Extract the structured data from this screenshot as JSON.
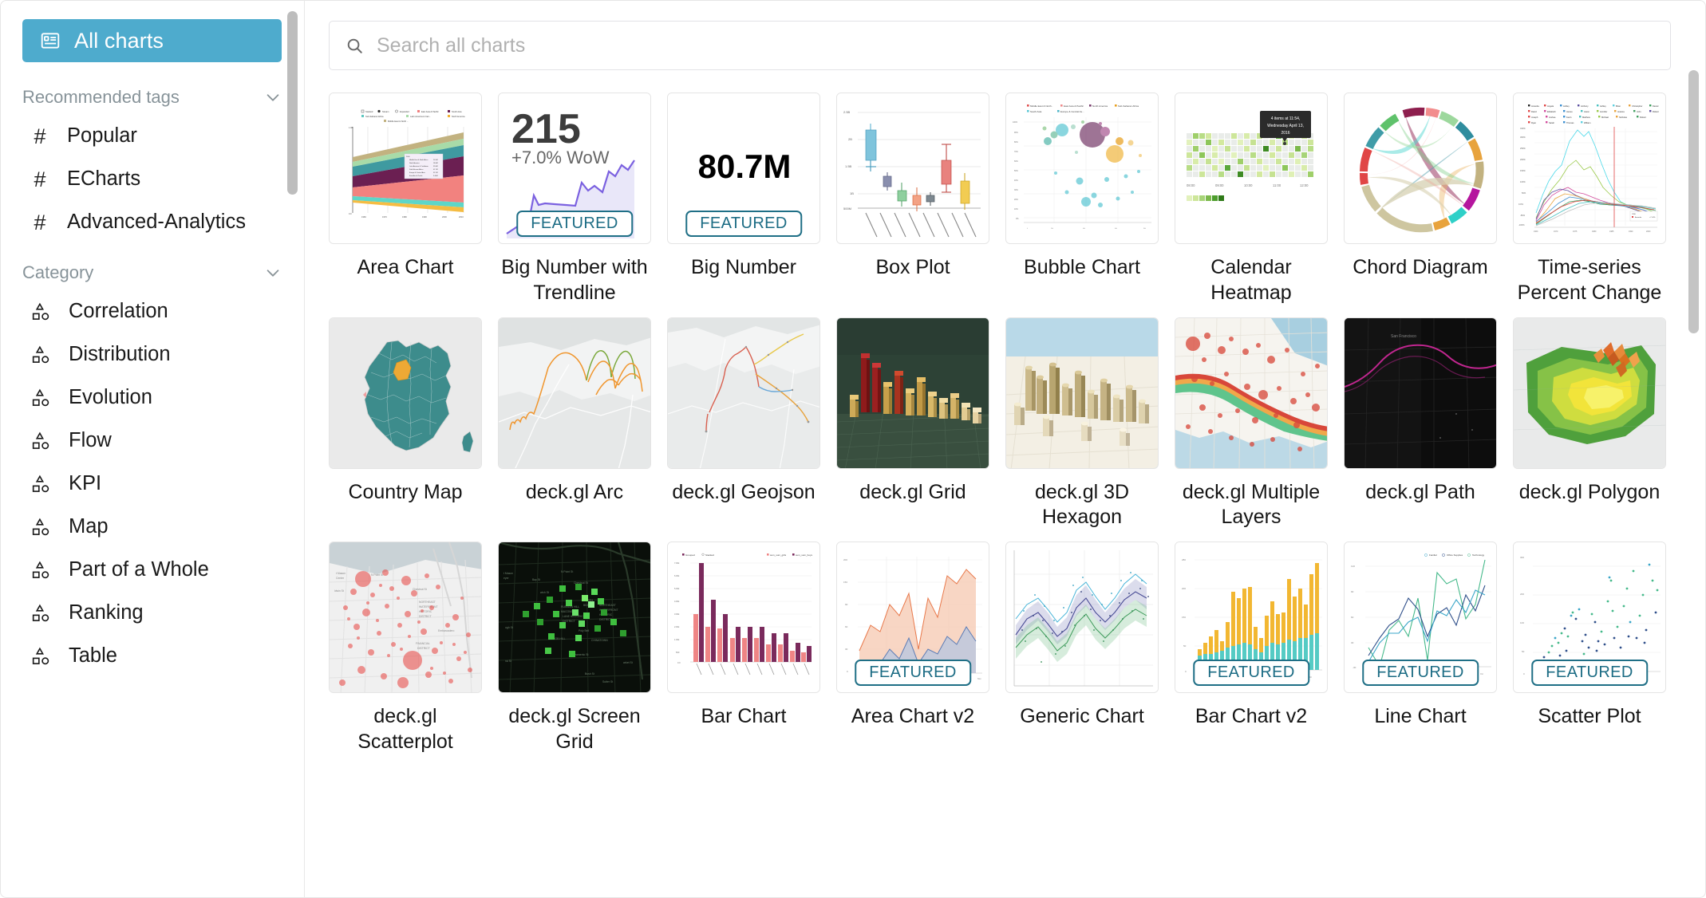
{
  "sidebar": {
    "all_charts": {
      "label": "All charts",
      "icon": "all-charts-icon"
    },
    "tags_header": {
      "label": "Recommended tags",
      "icon": "chevron-down-icon"
    },
    "tags": [
      {
        "label": "Popular",
        "icon": "hash-icon"
      },
      {
        "label": "ECharts",
        "icon": "hash-icon"
      },
      {
        "label": "Advanced-Analytics",
        "icon": "hash-icon"
      }
    ],
    "category_header": {
      "label": "Category",
      "icon": "chevron-down-icon"
    },
    "categories": [
      {
        "label": "Correlation",
        "icon": "shapes-icon"
      },
      {
        "label": "Distribution",
        "icon": "shapes-icon"
      },
      {
        "label": "Evolution",
        "icon": "shapes-icon"
      },
      {
        "label": "Flow",
        "icon": "shapes-icon"
      },
      {
        "label": "KPI",
        "icon": "shapes-icon"
      },
      {
        "label": "Map",
        "icon": "shapes-icon"
      },
      {
        "label": "Part of a Whole",
        "icon": "shapes-icon"
      },
      {
        "label": "Ranking",
        "icon": "shapes-icon"
      },
      {
        "label": "Table",
        "icon": "shapes-icon"
      }
    ]
  },
  "search": {
    "placeholder": "Search all charts",
    "value": "",
    "icon": "search-icon"
  },
  "badges": {
    "featured": "FEATURED"
  },
  "thumbnail_text": {
    "big_number_trendline_value": "215",
    "big_number_trendline_subheader": "+7.0% WoW",
    "big_number_value": "80.7M",
    "calendar_tooltip_line1": "4 items at 11:54,",
    "calendar_tooltip_line2": "Wednesday April 13,",
    "calendar_tooltip_line3": "2016",
    "calendar_axis": [
      "08:00",
      "09:00",
      "10:00",
      "11:00",
      "12:00"
    ]
  },
  "colors": {
    "accent": "#4eabcd",
    "featured_border": "#1f6f86",
    "featured_text": "#1c6c84",
    "sidebar_muted": "#879399",
    "text": "#151515"
  },
  "gallery": [
    {
      "name": "Area Chart",
      "thumb": "area-chart",
      "featured": false
    },
    {
      "name": "Big Number with Trendline",
      "thumb": "big-number-trendline",
      "featured": true
    },
    {
      "name": "Big Number",
      "thumb": "big-number",
      "featured": true
    },
    {
      "name": "Box Plot",
      "thumb": "box-plot",
      "featured": false
    },
    {
      "name": "Bubble Chart",
      "thumb": "bubble-chart",
      "featured": false
    },
    {
      "name": "Calendar Heatmap",
      "thumb": "calendar-heatmap",
      "featured": false
    },
    {
      "name": "Chord Diagram",
      "thumb": "chord-diagram",
      "featured": false
    },
    {
      "name": "Time-series Percent Change",
      "thumb": "time-series-percent-change",
      "featured": false
    },
    {
      "name": "Country Map",
      "thumb": "country-map",
      "featured": false
    },
    {
      "name": "deck.gl Arc",
      "thumb": "deckgl-arc",
      "featured": false
    },
    {
      "name": "deck.gl Geojson",
      "thumb": "deckgl-geojson",
      "featured": false
    },
    {
      "name": "deck.gl Grid",
      "thumb": "deckgl-grid",
      "featured": false
    },
    {
      "name": "deck.gl 3D Hexagon",
      "thumb": "deckgl-hexagon",
      "featured": false
    },
    {
      "name": "deck.gl Multiple Layers",
      "thumb": "deckgl-multi",
      "featured": false
    },
    {
      "name": "deck.gl Path",
      "thumb": "deckgl-path",
      "featured": false
    },
    {
      "name": "deck.gl Polygon",
      "thumb": "deckgl-polygon",
      "featured": false
    },
    {
      "name": "deck.gl Scatterplot",
      "thumb": "deckgl-scatterplot",
      "featured": false
    },
    {
      "name": "deck.gl Screen Grid",
      "thumb": "deckgl-screengrid",
      "featured": false
    },
    {
      "name": "Bar Chart",
      "thumb": "bar-chart",
      "featured": false
    },
    {
      "name": "Area Chart v2",
      "thumb": "area-chart-v2",
      "featured": true
    },
    {
      "name": "Generic Chart",
      "thumb": "generic-chart",
      "featured": false
    },
    {
      "name": "Bar Chart v2",
      "thumb": "bar-chart-v2",
      "featured": true
    },
    {
      "name": "Line Chart",
      "thumb": "line-chart",
      "featured": true
    },
    {
      "name": "Scatter Plot",
      "thumb": "scatter-plot",
      "featured": true
    }
  ],
  "chart_data": {
    "type": "table",
    "title": "Chart type gallery thumbnails",
    "thumbnails": [
      {
        "id": "area-chart",
        "type": "area",
        "series": [
          "Middle East & North Africa",
          "North America",
          "Latin America & Caribbean",
          "Sub-Saharan Africa",
          "Europe & Central Asia",
          "South Asia",
          "East Asia & Pacific"
        ],
        "x_ticks": [
          "1960",
          "1970",
          "1980",
          "1990",
          "2000",
          "2010"
        ]
      },
      {
        "id": "big-number-trendline",
        "type": "bignumber",
        "value": "215",
        "subheader": "+7.0% WoW"
      },
      {
        "id": "big-number",
        "type": "bignumber",
        "value": "80.7M"
      },
      {
        "id": "box-plot",
        "type": "boxplot",
        "box_count": 8
      },
      {
        "id": "bubble-chart",
        "type": "scatter",
        "bubbles": 60
      },
      {
        "id": "calendar-heatmap",
        "type": "heatmap",
        "x_ticks": [
          "08:00",
          "09:00",
          "10:00",
          "11:00",
          "12:00"
        ],
        "tooltip": "4 items at 11:54, Wednesday April 13, 2016"
      },
      {
        "id": "chord-diagram",
        "type": "chord",
        "arcs": 12
      },
      {
        "id": "time-series-percent-change",
        "type": "line",
        "y_ticks": [
          "340%",
          "300%",
          "250%",
          "200%",
          "150%",
          "100%",
          "50%",
          "0.0%",
          "-50%",
          "-100%"
        ],
        "x_ticks": [
          "1960",
          "1970",
          "1975",
          "1980",
          "1985",
          "1990",
          "2000",
          "2005"
        ]
      },
      {
        "id": "country-map",
        "type": "map",
        "region": "France"
      },
      {
        "id": "deckgl-arc",
        "type": "map"
      },
      {
        "id": "deckgl-geojson",
        "type": "map"
      },
      {
        "id": "deckgl-grid",
        "type": "map"
      },
      {
        "id": "deckgl-hexagon",
        "type": "map"
      },
      {
        "id": "deckgl-multi",
        "type": "map"
      },
      {
        "id": "deckgl-path",
        "type": "map"
      },
      {
        "id": "deckgl-polygon",
        "type": "map"
      },
      {
        "id": "deckgl-scatterplot",
        "type": "map"
      },
      {
        "id": "deckgl-screengrid",
        "type": "map"
      },
      {
        "id": "bar-chart",
        "type": "bar",
        "series": [
          "sum_sum_girls",
          "sum_sum_boys"
        ],
        "bars": 10
      },
      {
        "id": "area-chart-v2",
        "type": "area",
        "x_ticks": [
          "2011",
          "Feb",
          "Mar",
          "Apr",
          "May",
          "Jun",
          "Jul",
          "Aug",
          "Sep",
          "Oct",
          "Nov"
        ]
      },
      {
        "id": "generic-chart",
        "type": "line"
      },
      {
        "id": "bar-chart-v2",
        "type": "bar",
        "bars": 24
      },
      {
        "id": "line-chart",
        "type": "line",
        "legend": [
          "Fanilial",
          "Office Supplies",
          "Technology"
        ]
      },
      {
        "id": "scatter-plot",
        "type": "scatter",
        "points": 55
      }
    ]
  }
}
